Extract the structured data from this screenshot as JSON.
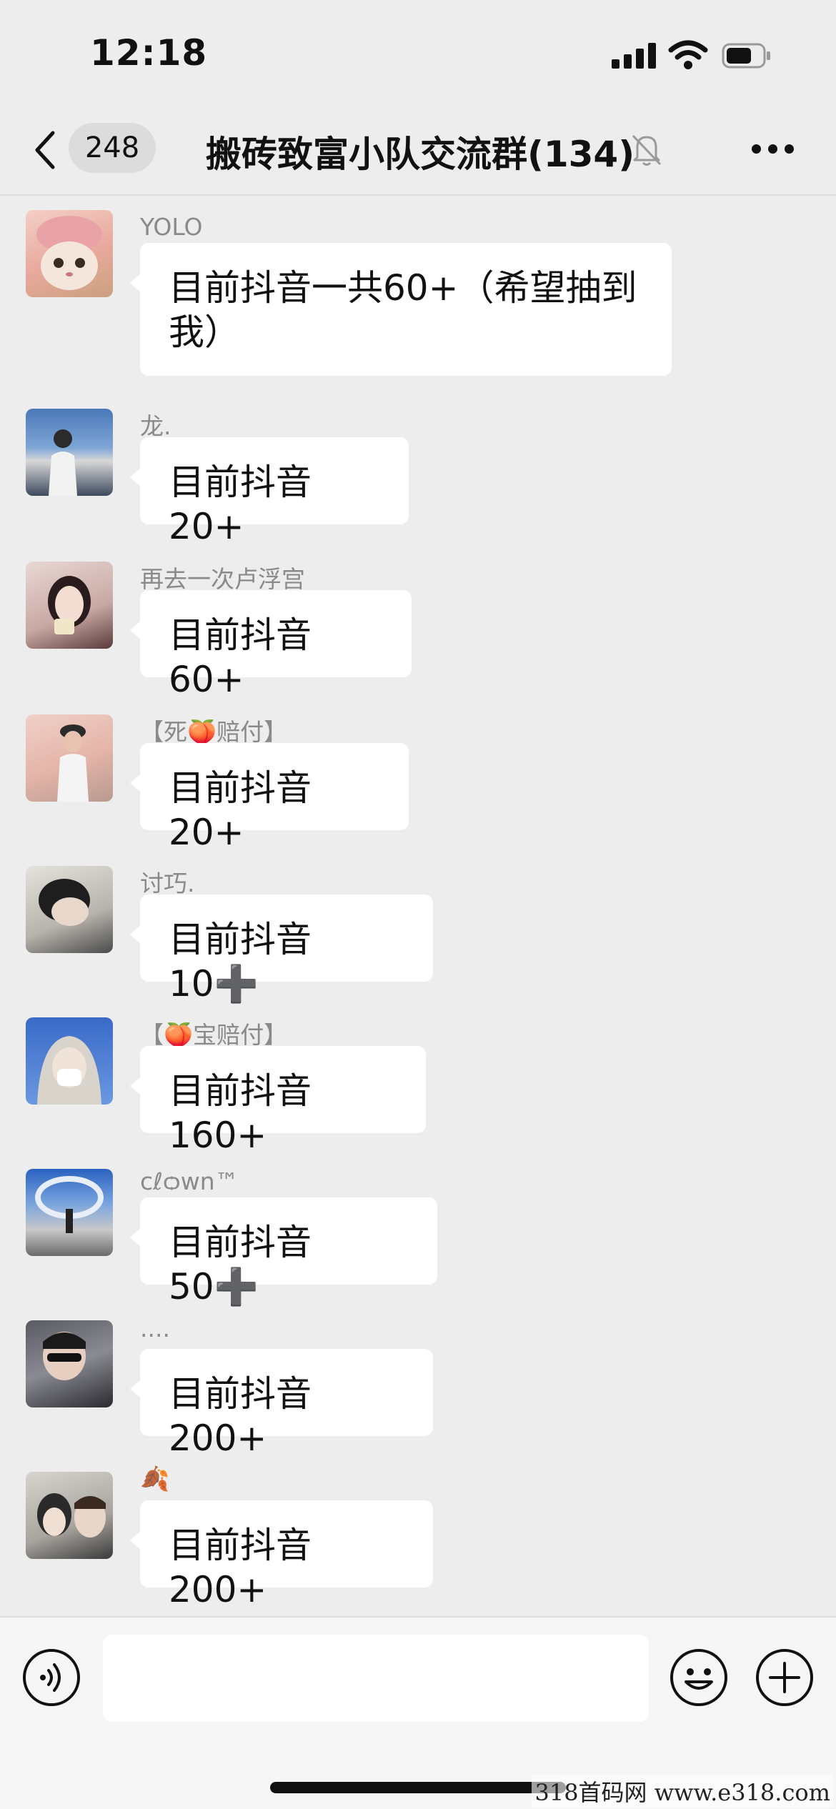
{
  "status_bar": {
    "time": "12:18",
    "battery_level": 0.7
  },
  "nav": {
    "unread_count": "248",
    "title": "搬砖致富小队交流群(134)",
    "icons": {
      "back": "chevron-left-icon",
      "mute": "bell-muted-icon",
      "more": "more-dots-icon"
    }
  },
  "messages": [
    {
      "sender": "YOLO",
      "text": "目前抖音一共60+（希望抽到我）",
      "avatar": "cat-avatar"
    },
    {
      "sender": "龙.",
      "text": "目前抖音 20+",
      "avatar": "photo-avatar"
    },
    {
      "sender": "再去一次卢浮宫",
      "text": "目前抖音 60+",
      "avatar": "photo-avatar"
    },
    {
      "sender": "【死🍑赔付】",
      "text": "目前抖音 20+",
      "avatar": "photo-avatar"
    },
    {
      "sender": "讨巧.",
      "text": "目前抖音 10➕",
      "avatar": "photo-avatar"
    },
    {
      "sender": "【🍑宝赔付】",
      "text": "目前抖音 160+",
      "avatar": "photo-avatar"
    },
    {
      "sender": "cℓѻwn™",
      "text": "目前抖音 50➕",
      "avatar": "photo-avatar"
    },
    {
      "sender": "....",
      "text": "目前抖音 200+",
      "avatar": "photo-avatar"
    },
    {
      "sender": "🍂",
      "text": "目前抖音 200+",
      "avatar": "photo-avatar"
    }
  ],
  "input_bar": {
    "message_value": "",
    "icons": {
      "voice": "voice-icon",
      "emoji": "emoji-icon",
      "plus": "plus-icon"
    }
  },
  "watermark": "318首码网 www.e318.com",
  "colors": {
    "background": "#ededed",
    "bubble": "#ffffff",
    "sender_name": "#8a8a8a",
    "text": "#111111"
  }
}
